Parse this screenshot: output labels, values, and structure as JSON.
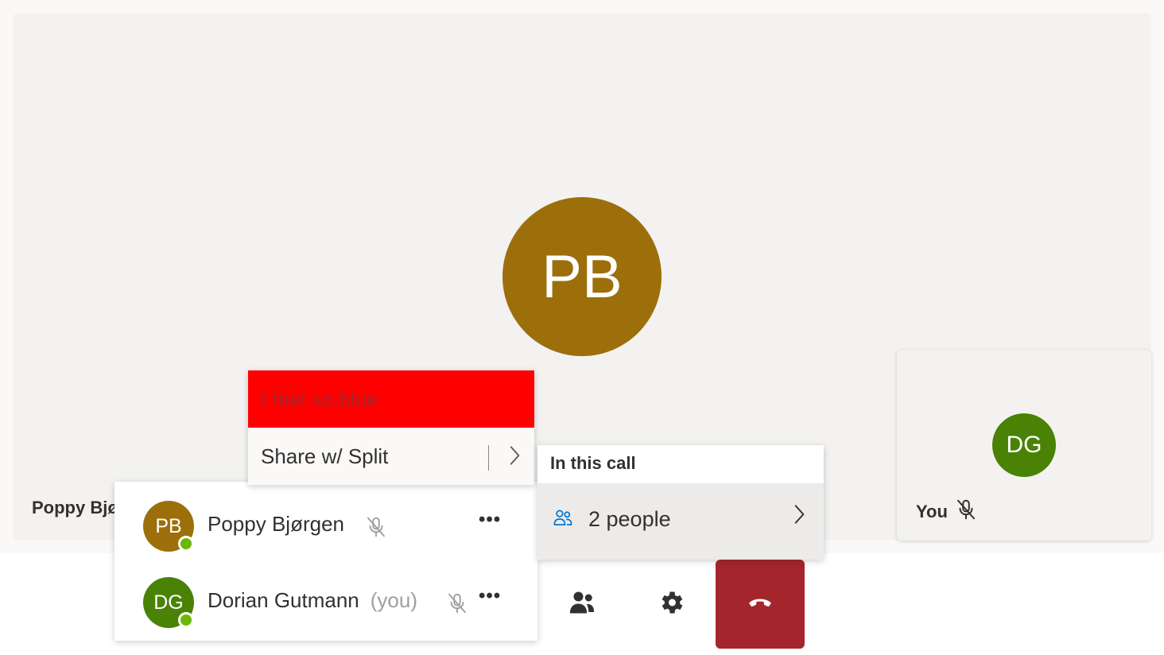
{
  "stage": {
    "main_participant": {
      "initials": "PB",
      "name": "Poppy Bjø",
      "avatar_color": "#9c6f0b"
    }
  },
  "self_tile": {
    "initials": "DG",
    "label": "You",
    "avatar_color": "#498205",
    "mic_icon": "mic-off-icon"
  },
  "context_menu": {
    "items": [
      {
        "label": "I feel so blue",
        "background": "#ff0000"
      },
      {
        "label": "Share w/ Split",
        "icon": "chevron-right-icon"
      }
    ]
  },
  "call_card": {
    "header": "In this call",
    "people_label": "2 people",
    "icon": "people-icon",
    "chevron": "chevron-right-icon"
  },
  "people_panel": {
    "participants": [
      {
        "initials": "PB",
        "name": "Poppy Bjørgen",
        "suffix": "",
        "avatar_color": "#9c6f0b",
        "presence": "available",
        "mic": "mic-off-icon",
        "more": "•••"
      },
      {
        "initials": "DG",
        "name": "Dorian Gutmann",
        "suffix": "(you)",
        "avatar_color": "#498205",
        "presence": "available",
        "mic": "mic-off-icon",
        "more": "•••"
      }
    ]
  },
  "toolbar": {
    "buttons": [
      {
        "name": "people-button",
        "icon": "people-icon"
      },
      {
        "name": "settings-button",
        "icon": "gear-icon"
      },
      {
        "name": "hang-up-button",
        "icon": "hang-up-icon",
        "color": "#a4262c"
      }
    ]
  },
  "colors": {
    "accent": "#0078d4",
    "presence_available": "#6bb700",
    "danger": "#a4262c"
  }
}
